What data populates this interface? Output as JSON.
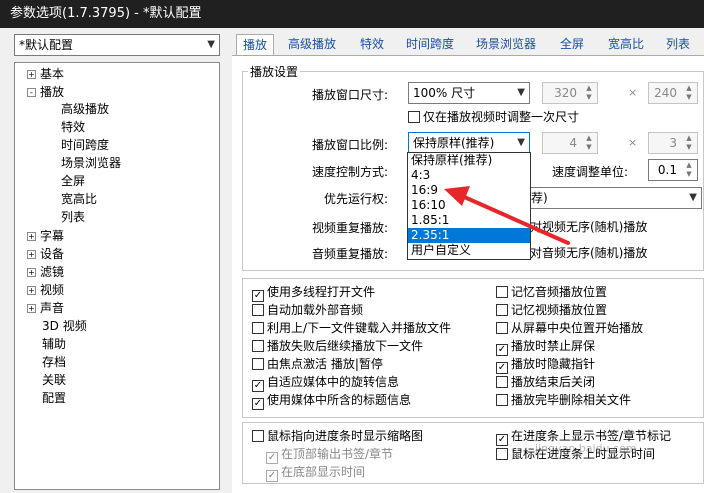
{
  "window": {
    "title": "参数选项(1.7.3795) - *默认配置"
  },
  "preset": {
    "value": "*默认配置"
  },
  "tree": {
    "items": [
      {
        "label": "基本",
        "expander": "+"
      },
      {
        "label": "播放",
        "expander": "-"
      },
      {
        "label": "高级播放"
      },
      {
        "label": "特效"
      },
      {
        "label": "时间跨度"
      },
      {
        "label": "场景浏览器"
      },
      {
        "label": "全屏"
      },
      {
        "label": "宽高比"
      },
      {
        "label": "列表"
      },
      {
        "label": "字幕",
        "expander": "+"
      },
      {
        "label": "设备",
        "expander": "+"
      },
      {
        "label": "滤镜",
        "expander": "+"
      },
      {
        "label": "视频",
        "expander": "+"
      },
      {
        "label": "声音",
        "expander": "+"
      },
      {
        "label": "3D 视频"
      },
      {
        "label": "辅助"
      },
      {
        "label": "存档"
      },
      {
        "label": "关联"
      },
      {
        "label": "配置"
      }
    ]
  },
  "tabs": [
    "播放",
    "高级播放",
    "特效",
    "时间跨度",
    "场景浏览器",
    "全屏",
    "宽高比",
    "列表"
  ],
  "settings": {
    "group_title": "播放设置",
    "window_size_label": "播放窗口尺寸:",
    "window_size_value": "100% 尺寸",
    "width": "320",
    "height": "240",
    "times": "×",
    "adjust_once_label": "仅在播放视频时调整一次尺寸",
    "ratio_label": "播放窗口比例:",
    "ratio_value": "保持原样(推荐)",
    "ratio_w": "4",
    "ratio_h": "3",
    "speed_mode_label": "速度控制方式:",
    "speed_unit_label": "速度调整单位:",
    "speed_unit_value": "0.1",
    "priority_label": "优先运行权:",
    "priority_value_partial": "荐)",
    "video_repeat_label": "视频重复播放:",
    "video_shuffle_partial": "对视频无序(随机)播放",
    "audio_repeat_label": "音频重复播放:",
    "audio_shuffle_partial": "对音频无序(随机)播放"
  },
  "ratio_dropdown": {
    "options": [
      "保持原样(推荐)",
      "4:3",
      "16:9",
      "16:10",
      "1.85:1",
      "2.35:1",
      "用户自定义"
    ],
    "highlighted": "2.35:1"
  },
  "options_left": [
    {
      "label": "使用多线程打开文件",
      "checked": true
    },
    {
      "label": "自动加载外部音频",
      "checked": false
    },
    {
      "label": "利用上/下一文件键载入并播放文件",
      "checked": false
    },
    {
      "label": "播放失败后继续播放下一文件",
      "checked": false
    },
    {
      "label": "由焦点激活 播放|暂停",
      "checked": false
    },
    {
      "label": "自适应媒体中的旋转信息",
      "checked": true
    },
    {
      "label": "使用媒体中所含的标题信息",
      "checked": true
    }
  ],
  "options_right": [
    {
      "label": "记忆音频播放位置",
      "checked": false
    },
    {
      "label": "记忆视频播放位置",
      "checked": false
    },
    {
      "label": "从屏幕中央位置开始播放",
      "checked": false
    },
    {
      "label": "播放时禁止屏保",
      "checked": true
    },
    {
      "label": "播放时隐藏指针",
      "checked": true
    },
    {
      "label": "播放结束后关闭",
      "checked": false
    },
    {
      "label": "播放完毕删除相关文件",
      "checked": false
    }
  ],
  "progress_left": [
    {
      "label": "鼠标指向进度条时显示缩略图",
      "checked": false,
      "disabled": false
    },
    {
      "label": "在顶部输出书签/章节",
      "checked": true,
      "disabled": true
    },
    {
      "label": "在底部显示时间",
      "checked": true,
      "disabled": true
    }
  ],
  "progress_right": [
    {
      "label": "在进度条上显示书签/章节标记",
      "checked": true
    },
    {
      "label": "鼠标在进度条上时显示时间",
      "checked": false
    }
  ],
  "watermark": "jingyan.baidu.com",
  "colors": {
    "accent": "#0078d7",
    "arrow": "#e8262a",
    "titlebar": "#202020"
  }
}
